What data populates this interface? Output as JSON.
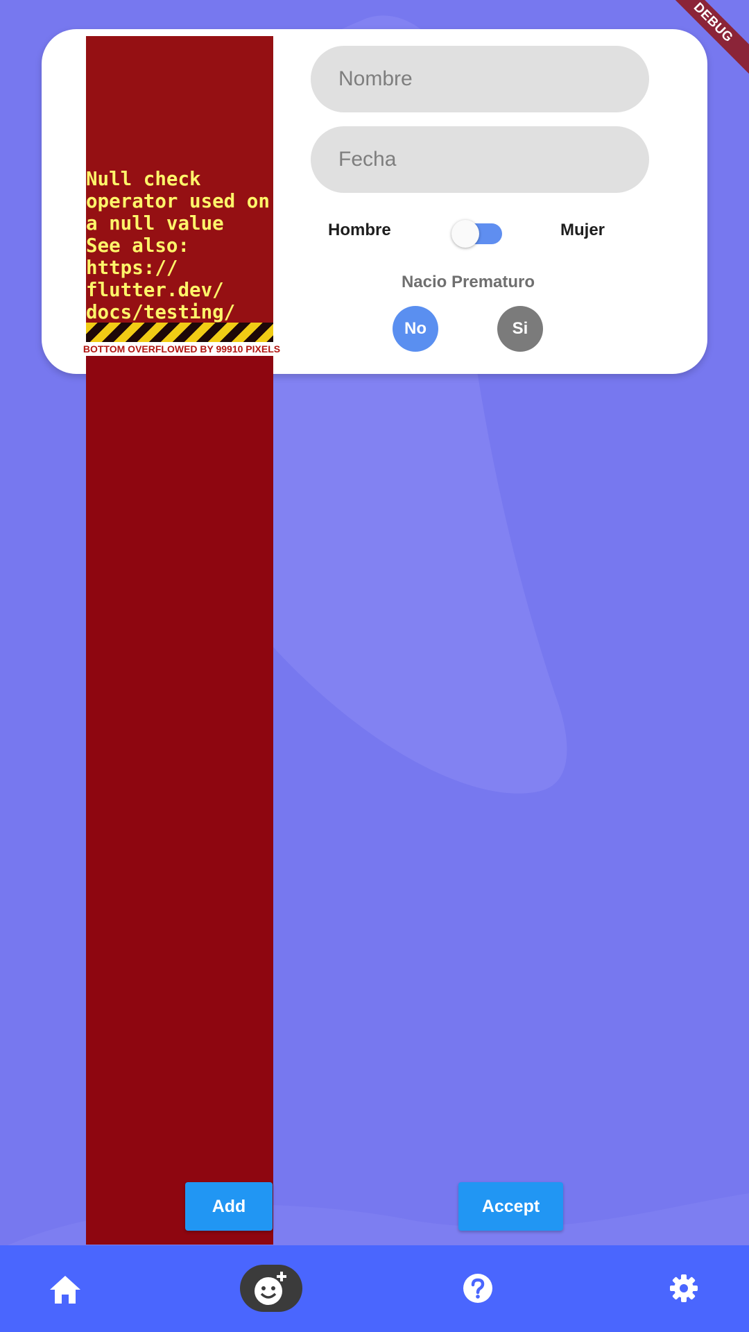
{
  "form": {
    "nombre_placeholder": "Nombre",
    "fecha_placeholder": "Fecha",
    "gender_left": "Hombre",
    "gender_right": "Mujer",
    "premature_label": "Nacio Prematuro",
    "premature_no": "No",
    "premature_si": "Si"
  },
  "error": {
    "message": "Null check\noperator used on\na null value\nSee also:\nhttps://\nflutter.dev/\ndocs/testing/\nerrors",
    "overflow_banner": "BOTTOM OVERFLOWED BY 99910 PIXELS"
  },
  "actions": {
    "add_label": "Add",
    "accept_label": "Accept"
  },
  "nav": {
    "items": [
      {
        "icon": "home-icon"
      },
      {
        "icon": "face-add-icon",
        "selected": true
      },
      {
        "icon": "help-icon"
      },
      {
        "icon": "settings-icon"
      }
    ]
  },
  "debug_banner": "DEBUG",
  "colors": {
    "background": "#7778ef",
    "nav_bar": "#4a66fe",
    "button_blue": "#2196f3",
    "error_red": "#8e0610",
    "error_text": "#fdf56a"
  }
}
